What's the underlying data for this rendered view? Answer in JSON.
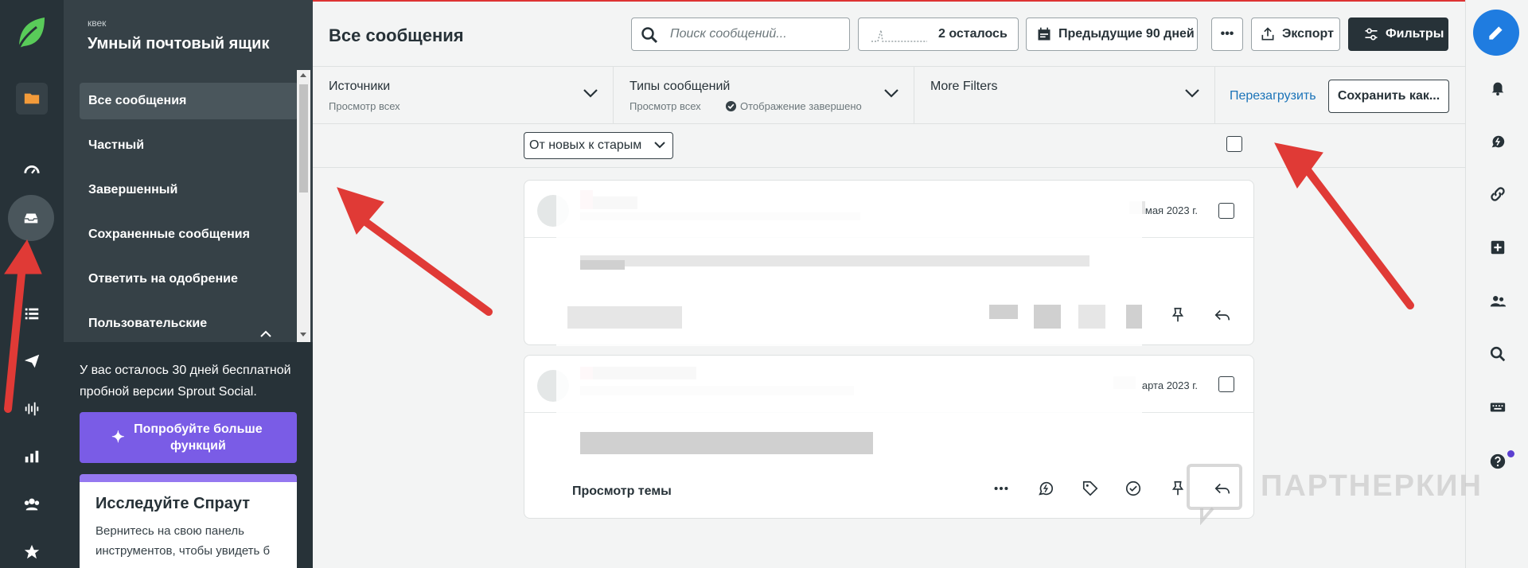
{
  "app": {
    "workspace": "квек",
    "section_title": "Умный почтовый ящик",
    "page_title": "Все сообщения"
  },
  "sidebar": {
    "items": [
      {
        "label": "Все сообщения"
      },
      {
        "label": "Частный"
      },
      {
        "label": "Завершенный"
      },
      {
        "label": "Сохраненные сообщения"
      },
      {
        "label": "Ответить на одобрение"
      },
      {
        "label": "Пользовательские"
      }
    ]
  },
  "trial": {
    "text": "У вас осталось 30 дней бесплатной пробной версии Sprout Social.",
    "button": "Попробуйте больше функций",
    "card_title": "Исследуйте Спраут",
    "card_text": "Вернитесь на свою панель инструментов, чтобы увидеть б"
  },
  "toolbar": {
    "search_placeholder": "Поиск сообщений...",
    "remaining": "2 осталось",
    "period": "Предыдущие 90 дней",
    "more": "•••",
    "export": "Экспорт",
    "filters": "Фильтры"
  },
  "filters": {
    "sources_title": "Источники",
    "sources_sub": "Просмотр всех",
    "types_title": "Типы сообщений",
    "types_sub": "Просмотр всех",
    "types_status": "Отображение завершено",
    "more_title": "More Filters",
    "reload": "Перезагрузить",
    "save": "Сохранить как..."
  },
  "sort": {
    "value": "От новых к старым"
  },
  "messages": [
    {
      "date": "мая 2023 г."
    },
    {
      "date": "арта 2023 г.",
      "thread": "Просмотр темы"
    }
  ],
  "watermark": "ПАРТНЕРКИН",
  "colors": {
    "rail": "#273238",
    "sidebar": "#364147",
    "accent_purple": "#7a5ce6",
    "compose_blue": "#1f7ce0",
    "logo_green": "#59cb59",
    "link_blue": "#1a73b8",
    "annotation_red": "#e03a36"
  }
}
